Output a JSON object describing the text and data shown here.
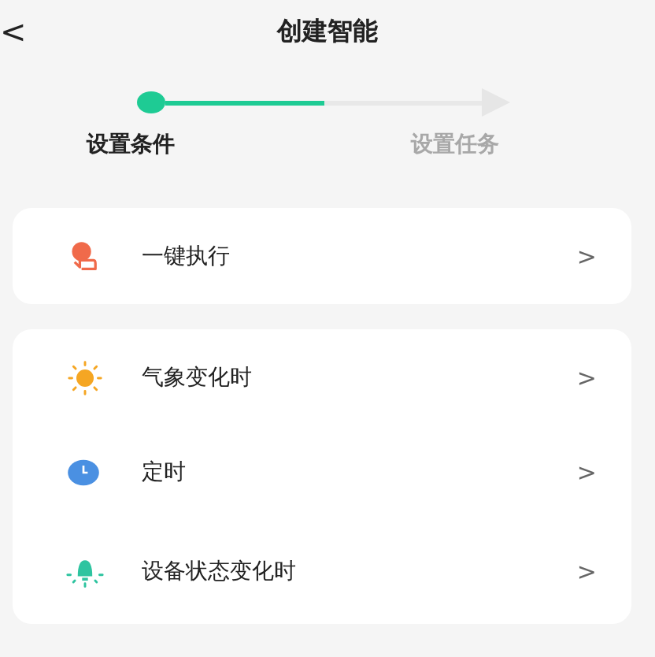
{
  "header": {
    "back": "<",
    "title": "创建智能"
  },
  "steps": [
    {
      "label": "设置条件",
      "selected": true
    },
    {
      "label": "设置任务",
      "selected": false
    }
  ],
  "groups": [
    {
      "items": [
        {
          "kind": "hand",
          "label": "一键执行",
          "chevron": ">"
        }
      ]
    },
    {
      "items": [
        {
          "kind": "sun",
          "label": "气象变化时",
          "chevron": ">"
        },
        {
          "kind": "clock",
          "label": "定时",
          "chevron": ">"
        },
        {
          "kind": "lamp",
          "label": "设备状态变化时",
          "chevron": ">"
        }
      ]
    }
  ]
}
